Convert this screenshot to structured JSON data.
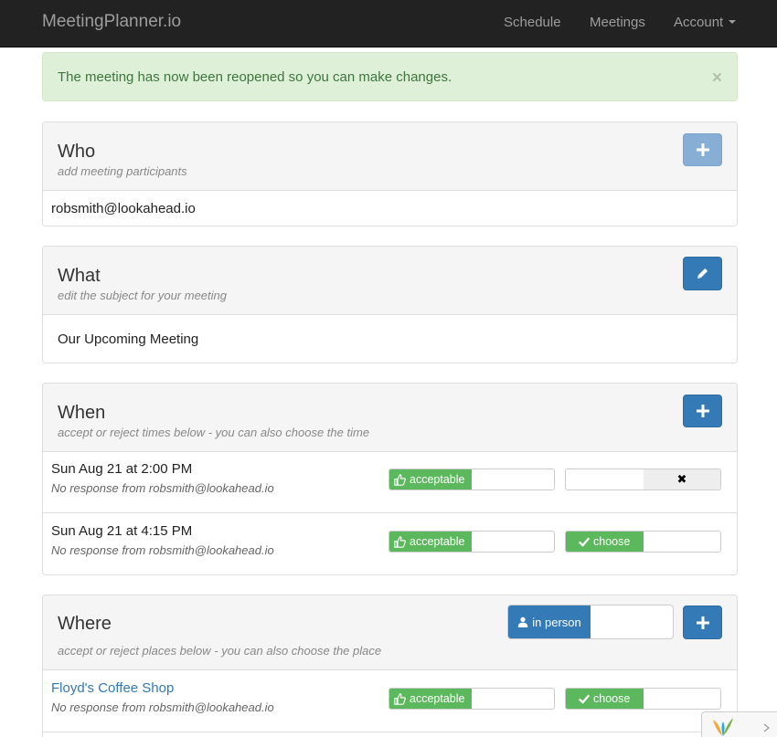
{
  "navbar": {
    "brand": "MeetingPlanner.io",
    "links": [
      "Schedule",
      "Meetings",
      "Account"
    ]
  },
  "alert": {
    "message": "The meeting has now been reopened so you can make changes.",
    "close": "×"
  },
  "who": {
    "title": "Who",
    "subtitle": "add meeting participants",
    "participant": "robsmith@lookahead.io",
    "add_icon": "plus-icon"
  },
  "what": {
    "title": "What",
    "subtitle": "edit the subject for your meeting",
    "subject": "Our Upcoming Meeting",
    "edit_icon": "pencil-icon"
  },
  "when": {
    "title": "When",
    "subtitle": "accept or reject times below - you can also choose the time",
    "rows": [
      {
        "time": "Sun Aug 21 at 2:00 PM",
        "status": "No response from robsmith@lookahead.io",
        "accept_label": "acceptable",
        "choose_label": "",
        "reject_label": "✖"
      },
      {
        "time": "Sun Aug 21 at 4:15 PM",
        "status": "No response from robsmith@lookahead.io",
        "accept_label": "acceptable",
        "choose_label": "choose"
      }
    ]
  },
  "where": {
    "title": "Where",
    "subtitle": "accept or reject places below  - you can also choose the place",
    "in_person_label": "in person",
    "rows": [
      {
        "place": "Floyd's Coffee Shop",
        "status": "No response from robsmith@lookahead.io",
        "accept_label": "acceptable",
        "choose_label": "choose"
      }
    ]
  },
  "colors": {
    "primary": "#337ab7",
    "success": "#5cb85c",
    "navbar": "#222222",
    "alert_bg": "#dff0d8",
    "alert_text": "#3c763d"
  }
}
